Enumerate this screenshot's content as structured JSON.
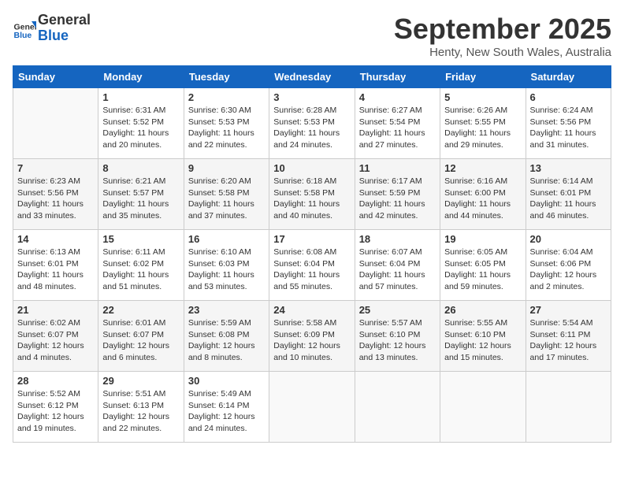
{
  "header": {
    "logo_line1": "General",
    "logo_line2": "Blue",
    "month": "September 2025",
    "location": "Henty, New South Wales, Australia"
  },
  "days_of_week": [
    "Sunday",
    "Monday",
    "Tuesday",
    "Wednesday",
    "Thursday",
    "Friday",
    "Saturday"
  ],
  "weeks": [
    [
      {
        "day": "",
        "info": ""
      },
      {
        "day": "1",
        "info": "Sunrise: 6:31 AM\nSunset: 5:52 PM\nDaylight: 11 hours\nand 20 minutes."
      },
      {
        "day": "2",
        "info": "Sunrise: 6:30 AM\nSunset: 5:53 PM\nDaylight: 11 hours\nand 22 minutes."
      },
      {
        "day": "3",
        "info": "Sunrise: 6:28 AM\nSunset: 5:53 PM\nDaylight: 11 hours\nand 24 minutes."
      },
      {
        "day": "4",
        "info": "Sunrise: 6:27 AM\nSunset: 5:54 PM\nDaylight: 11 hours\nand 27 minutes."
      },
      {
        "day": "5",
        "info": "Sunrise: 6:26 AM\nSunset: 5:55 PM\nDaylight: 11 hours\nand 29 minutes."
      },
      {
        "day": "6",
        "info": "Sunrise: 6:24 AM\nSunset: 5:56 PM\nDaylight: 11 hours\nand 31 minutes."
      }
    ],
    [
      {
        "day": "7",
        "info": "Sunrise: 6:23 AM\nSunset: 5:56 PM\nDaylight: 11 hours\nand 33 minutes."
      },
      {
        "day": "8",
        "info": "Sunrise: 6:21 AM\nSunset: 5:57 PM\nDaylight: 11 hours\nand 35 minutes."
      },
      {
        "day": "9",
        "info": "Sunrise: 6:20 AM\nSunset: 5:58 PM\nDaylight: 11 hours\nand 37 minutes."
      },
      {
        "day": "10",
        "info": "Sunrise: 6:18 AM\nSunset: 5:58 PM\nDaylight: 11 hours\nand 40 minutes."
      },
      {
        "day": "11",
        "info": "Sunrise: 6:17 AM\nSunset: 5:59 PM\nDaylight: 11 hours\nand 42 minutes."
      },
      {
        "day": "12",
        "info": "Sunrise: 6:16 AM\nSunset: 6:00 PM\nDaylight: 11 hours\nand 44 minutes."
      },
      {
        "day": "13",
        "info": "Sunrise: 6:14 AM\nSunset: 6:01 PM\nDaylight: 11 hours\nand 46 minutes."
      }
    ],
    [
      {
        "day": "14",
        "info": "Sunrise: 6:13 AM\nSunset: 6:01 PM\nDaylight: 11 hours\nand 48 minutes."
      },
      {
        "day": "15",
        "info": "Sunrise: 6:11 AM\nSunset: 6:02 PM\nDaylight: 11 hours\nand 51 minutes."
      },
      {
        "day": "16",
        "info": "Sunrise: 6:10 AM\nSunset: 6:03 PM\nDaylight: 11 hours\nand 53 minutes."
      },
      {
        "day": "17",
        "info": "Sunrise: 6:08 AM\nSunset: 6:04 PM\nDaylight: 11 hours\nand 55 minutes."
      },
      {
        "day": "18",
        "info": "Sunrise: 6:07 AM\nSunset: 6:04 PM\nDaylight: 11 hours\nand 57 minutes."
      },
      {
        "day": "19",
        "info": "Sunrise: 6:05 AM\nSunset: 6:05 PM\nDaylight: 11 hours\nand 59 minutes."
      },
      {
        "day": "20",
        "info": "Sunrise: 6:04 AM\nSunset: 6:06 PM\nDaylight: 12 hours\nand 2 minutes."
      }
    ],
    [
      {
        "day": "21",
        "info": "Sunrise: 6:02 AM\nSunset: 6:07 PM\nDaylight: 12 hours\nand 4 minutes."
      },
      {
        "day": "22",
        "info": "Sunrise: 6:01 AM\nSunset: 6:07 PM\nDaylight: 12 hours\nand 6 minutes."
      },
      {
        "day": "23",
        "info": "Sunrise: 5:59 AM\nSunset: 6:08 PM\nDaylight: 12 hours\nand 8 minutes."
      },
      {
        "day": "24",
        "info": "Sunrise: 5:58 AM\nSunset: 6:09 PM\nDaylight: 12 hours\nand 10 minutes."
      },
      {
        "day": "25",
        "info": "Sunrise: 5:57 AM\nSunset: 6:10 PM\nDaylight: 12 hours\nand 13 minutes."
      },
      {
        "day": "26",
        "info": "Sunrise: 5:55 AM\nSunset: 6:10 PM\nDaylight: 12 hours\nand 15 minutes."
      },
      {
        "day": "27",
        "info": "Sunrise: 5:54 AM\nSunset: 6:11 PM\nDaylight: 12 hours\nand 17 minutes."
      }
    ],
    [
      {
        "day": "28",
        "info": "Sunrise: 5:52 AM\nSunset: 6:12 PM\nDaylight: 12 hours\nand 19 minutes."
      },
      {
        "day": "29",
        "info": "Sunrise: 5:51 AM\nSunset: 6:13 PM\nDaylight: 12 hours\nand 22 minutes."
      },
      {
        "day": "30",
        "info": "Sunrise: 5:49 AM\nSunset: 6:14 PM\nDaylight: 12 hours\nand 24 minutes."
      },
      {
        "day": "",
        "info": ""
      },
      {
        "day": "",
        "info": ""
      },
      {
        "day": "",
        "info": ""
      },
      {
        "day": "",
        "info": ""
      }
    ]
  ]
}
